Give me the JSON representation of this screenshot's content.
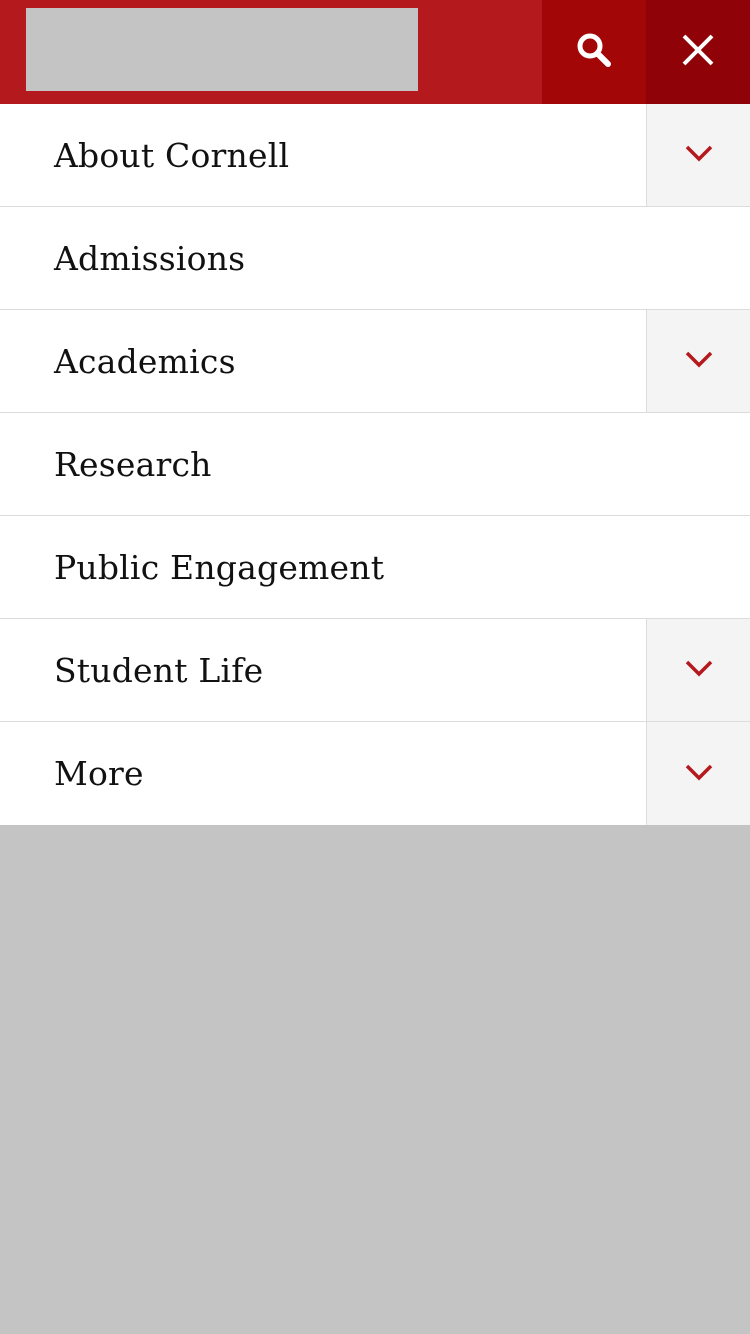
{
  "header": {
    "search_icon": "search-icon",
    "close_icon": "close-icon"
  },
  "colors": {
    "brand_red": "#b3191d",
    "search_bg": "#a20606",
    "close_bg": "#8f0207",
    "chevron": "#b3191d"
  },
  "menu": {
    "items": [
      {
        "label": "About Cornell",
        "expandable": true
      },
      {
        "label": "Admissions",
        "expandable": false
      },
      {
        "label": "Academics",
        "expandable": true
      },
      {
        "label": "Research",
        "expandable": false
      },
      {
        "label": "Public Engagement",
        "expandable": false
      },
      {
        "label": "Student Life",
        "expandable": true
      },
      {
        "label": "More",
        "expandable": true
      }
    ]
  }
}
